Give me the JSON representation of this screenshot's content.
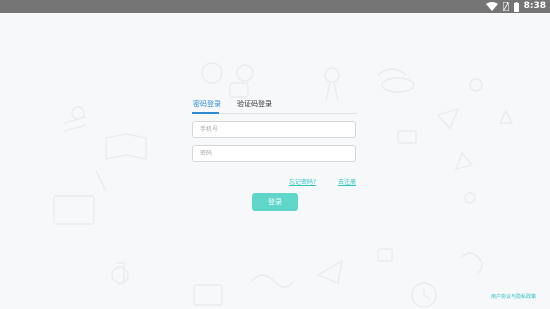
{
  "status_bar": {
    "time": "8:38"
  },
  "login": {
    "tabs": [
      {
        "label": "密码登录",
        "active": true
      },
      {
        "label": "验证码登录",
        "active": false
      }
    ],
    "phone_placeholder": "手机号",
    "password_placeholder": "密码",
    "forgot_password": "忘记密码?",
    "register": "去注册",
    "login_button": "登录"
  },
  "footer": {
    "privacy_link": "用户协议与隐私政策"
  },
  "colors": {
    "status_bar": "#757575",
    "accent_blue": "#2e8bd6",
    "button_teal": "#5fd6c9",
    "link_teal": "#2ec4c0"
  },
  "icons": [
    "wifi-icon",
    "sim-icon",
    "battery-icon"
  ]
}
